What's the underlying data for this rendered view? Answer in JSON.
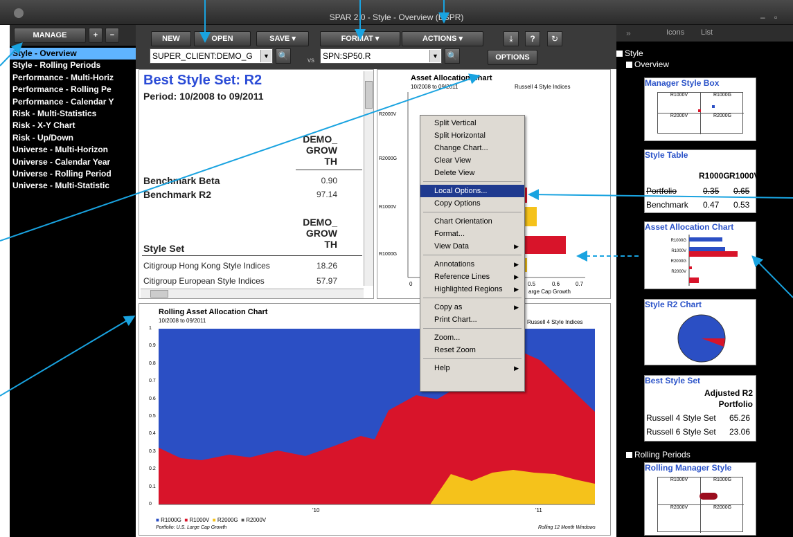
{
  "window": {
    "title": "SPAR 2.0 - Style - Overview (BSPR)"
  },
  "left_panel": {
    "manage_label": "MANAGE",
    "add_label": "+",
    "remove_label": "−",
    "items": [
      "Style - Overview",
      "Style - Rolling Periods",
      "Performance - Multi-Horiz",
      "Performance - Rolling Pe",
      "Performance - Calendar Y",
      "Risk - Multi-Statistics",
      "Risk - X-Y Chart",
      "Risk - Up/Down",
      "Universe - Multi-Horizon",
      "Universe - Calendar Year",
      "Universe - Rolling Period",
      "Universe - Multi-Statistic"
    ],
    "selected": "Style - Overview"
  },
  "toolbar": {
    "new_label": "NEW",
    "open_label": "OPEN",
    "save_label": "SAVE",
    "format_label": "FORMAT",
    "actions_label": "ACTIONS",
    "options_label": "OPTIONS",
    "client_value": "SUPER_CLIENT:DEMO_G",
    "benchmark_value": "SPN:SP50.R",
    "vs_label": "vs",
    "help_label": "?"
  },
  "stats": {
    "title": "Best Style Set: R2",
    "period": "Period: 10/2008 to 09/2011",
    "col_header": "DEMO_ GROW TH",
    "rows": [
      {
        "label": "Benchmark Beta",
        "value": "0.90"
      },
      {
        "label": "Benchmark R2",
        "value": "97.14"
      }
    ],
    "style_set_header": "Style Set",
    "col_header2": "DEMO_ GROW TH",
    "set_rows": [
      {
        "label": "Citigroup Hong Kong Style Indices",
        "value": "18.26"
      },
      {
        "label": "Citigroup European Style Indices",
        "value": "57.97"
      }
    ]
  },
  "aa_chart": {
    "title": "Asset Allocation Chart",
    "period": "10/2008 to 09/2011",
    "source": "Russell 4 Style Indices",
    "xaxis_note": "arge Cap Growth"
  },
  "rolling_chart": {
    "title": "Rolling Asset Allocation Chart",
    "period": "10/2008 to 09/2011",
    "source": "Russell 4 Style Indices",
    "legend": [
      "R1000G",
      "R1000V",
      "R2000G",
      "R2000V"
    ],
    "footer_left": "Portfolio: U.S. Large Cap Growth",
    "footer_right": "Rolling 12 Month Windows",
    "yticks": [
      "1",
      "0.9",
      "0.8",
      "0.7",
      "0.6",
      "0.5",
      "0.4",
      "0.3",
      "0.2",
      "0.1",
      "0"
    ],
    "xticks": [
      "'10",
      "'11"
    ]
  },
  "context_menu": {
    "items": [
      {
        "label": "Split Vertical"
      },
      {
        "label": "Split Horizontal"
      },
      {
        "label": "Change Chart..."
      },
      {
        "label": "Clear View"
      },
      {
        "label": "Delete View"
      },
      {
        "sep": true
      },
      {
        "label": "Local Options...",
        "highlighted": true
      },
      {
        "label": "Copy Options"
      },
      {
        "sep": true
      },
      {
        "label": "Chart Orientation"
      },
      {
        "label": "Format..."
      },
      {
        "label": "View Data",
        "sub": true
      },
      {
        "sep": true
      },
      {
        "label": "Annotations",
        "sub": true
      },
      {
        "label": "Reference Lines",
        "sub": true
      },
      {
        "label": "Highlighted Regions",
        "sub": true
      },
      {
        "sep": true
      },
      {
        "label": "Copy as",
        "sub": true
      },
      {
        "label": "Print Chart..."
      },
      {
        "sep": true
      },
      {
        "label": "Zoom..."
      },
      {
        "label": "Reset Zoom"
      },
      {
        "sep": true
      },
      {
        "label": "Help",
        "sub": true
      }
    ]
  },
  "right_panel": {
    "tab_icons": "Icons",
    "tab_list": "List",
    "tree": {
      "style": "Style",
      "overview": "Overview",
      "rolling": "Rolling Periods"
    },
    "cards": {
      "msb": {
        "title": "Manager Style Box",
        "cells": [
          "R1000V",
          "R1000G",
          "R2000V",
          "R2000G"
        ]
      },
      "style_table": {
        "title": "Style Table",
        "h1": "R1000G",
        "h2": "R1000V",
        "r1": "Portfolio",
        "r1v1": "0.35",
        "r1v2": "0.65",
        "r2": "Benchmark",
        "r2v1": "0.47",
        "r2v2": "0.53"
      },
      "aa": {
        "title": "Asset Allocation Chart",
        "labels": [
          "R1000G",
          "R1000V",
          "R2000G",
          "R2000V"
        ]
      },
      "r2": {
        "title": "Style R2 Chart"
      },
      "bss": {
        "title": "Best Style Set",
        "h1": "Adjusted R2",
        "h2": "Portfolio",
        "rows": [
          {
            "label": "Russell 4 Style Set",
            "value": "65.26"
          },
          {
            "label": "Russell 6 Style Set",
            "value": "23.06"
          }
        ]
      },
      "rms": {
        "title": "Rolling Manager Style",
        "cells": [
          "R1000V",
          "R1000G",
          "R2000V",
          "R2000G"
        ]
      }
    }
  },
  "colors": {
    "blue": "#2b4fc4",
    "red": "#d8142a",
    "yellow": "#f5c21b",
    "accent": "#19a3e0",
    "bg": "#000000"
  }
}
